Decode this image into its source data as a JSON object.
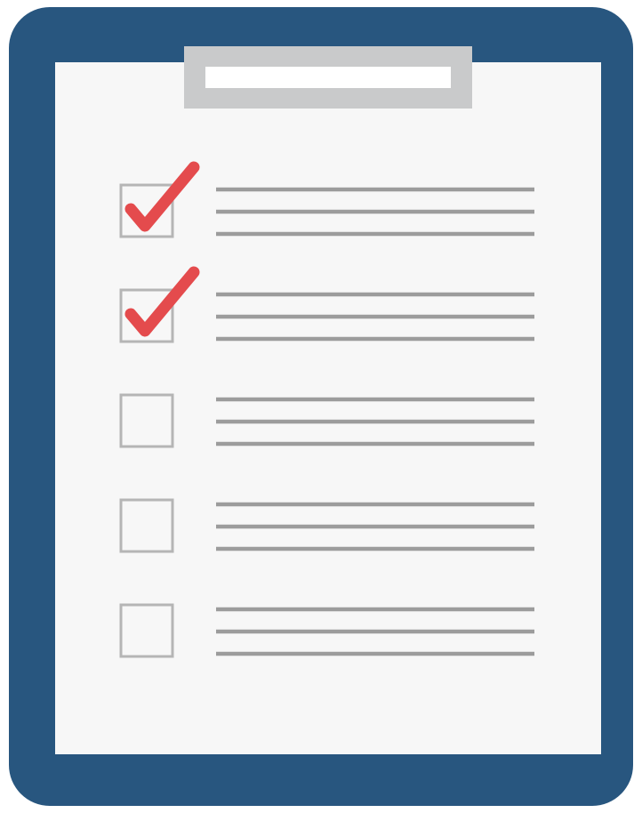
{
  "illustration": {
    "subject": "clipboard-checklist",
    "colors": {
      "board": "#28567f",
      "paper": "#f7f7f7",
      "clip_outer": "#c9cacb",
      "clip_inner": "#ffffff",
      "checkbox_border": "#b5b5b5",
      "checkmark": "#e44b4d",
      "line": "#9c9c9c"
    }
  },
  "checklist": {
    "items": [
      {
        "checked": true,
        "line_count": 3
      },
      {
        "checked": true,
        "line_count": 3
      },
      {
        "checked": false,
        "line_count": 3
      },
      {
        "checked": false,
        "line_count": 3
      },
      {
        "checked": false,
        "line_count": 3
      }
    ]
  }
}
